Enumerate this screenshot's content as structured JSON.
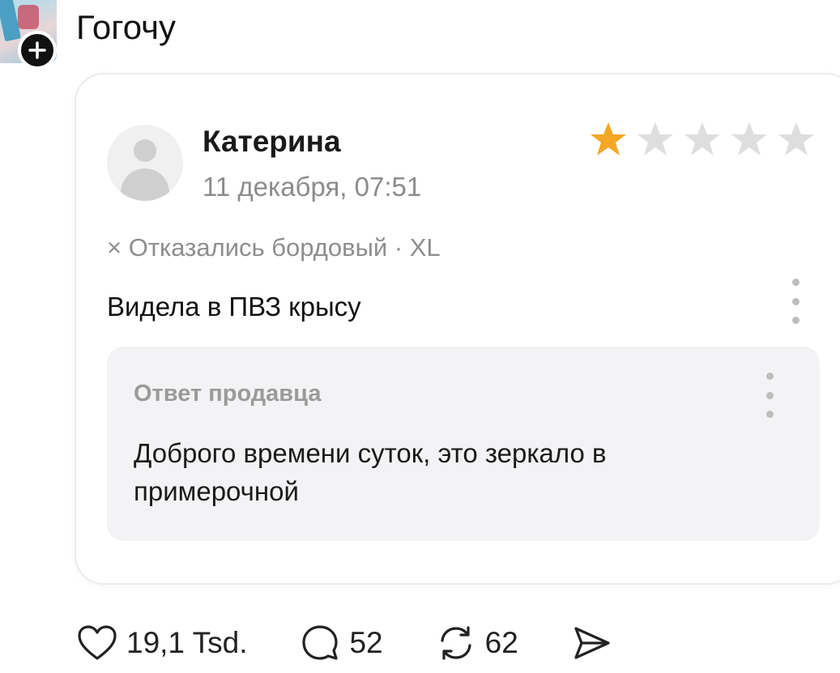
{
  "post": {
    "username": "Гогочу"
  },
  "review": {
    "reviewer_name": "Катерина",
    "date": "11 декабря, 07:51",
    "rating": 1,
    "max_rating": 5,
    "star_color": "#f5a623",
    "star_empty_color": "#dedede",
    "variant": "× Отказались  бордовый · XL",
    "text": "Видела в ПВЗ крысу",
    "seller_reply": {
      "title": "Ответ продавца",
      "text": "Доброго времени суток, это зеркало в примерочной"
    }
  },
  "actions": {
    "likes": "19,1 Tsd.",
    "comments": "52",
    "reposts": "62"
  },
  "icons": {
    "follow": "plus-icon",
    "like": "heart-icon",
    "comment": "comment-bubble-icon",
    "repost": "repost-icon",
    "share": "send-icon",
    "more": "more-vertical-icon",
    "star": "star-icon",
    "avatar_placeholder": "user-placeholder-icon"
  }
}
